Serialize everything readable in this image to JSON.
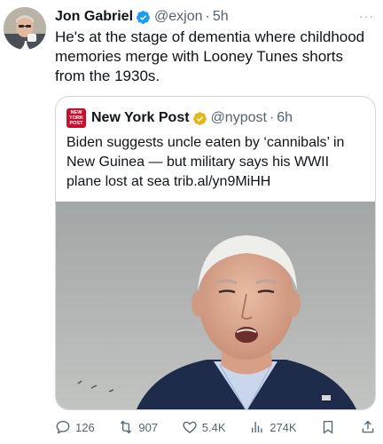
{
  "author": {
    "name": "Jon Gabriel",
    "handle": "@exjon",
    "separator": "·",
    "time": "5h",
    "more": "···"
  },
  "tweet": {
    "text": "He's at the stage of dementia where childhood memories merge with Looney Tunes shorts from the 1930s."
  },
  "quoted": {
    "logo_text": "NEW YORK POST",
    "name": "New York Post",
    "handle": "@nypost",
    "separator": "·",
    "time": "6h",
    "text": "Biden suggests uncle eaten by ‘cannibals’ in New Guinea — but military says his WWII plane lost at sea trib.al/yn9MiHH"
  },
  "actions": {
    "replies": "126",
    "reposts": "907",
    "likes": "5.4K",
    "views": "274K"
  },
  "colors": {
    "verified_badge": "#1d9bf0",
    "org_badge": "#e2b719",
    "text_secondary": "#536471",
    "border": "#cfd9de",
    "nypost_red": "#c8102e"
  },
  "icons": [
    "verified-badge-icon",
    "gold-verified-badge-icon",
    "more-icon",
    "reply-icon",
    "repost-icon",
    "like-icon",
    "views-icon",
    "bookmark-icon",
    "share-icon"
  ]
}
